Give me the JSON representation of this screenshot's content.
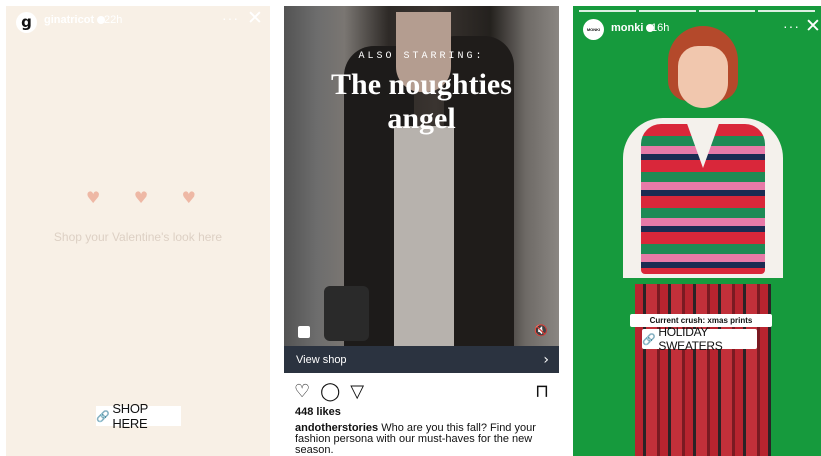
{
  "story1": {
    "avatar_letter": "g",
    "username": "ginatricot",
    "time": "22h",
    "more_glyph": "···",
    "close_glyph": "✕",
    "heart_glyph": "♥",
    "message": "Shop your Valentine's look here",
    "shop_button": "SHOP HERE",
    "link_glyph": "🔗"
  },
  "post2": {
    "subhead": "ALSO STARRING:",
    "headline_line1": "The noughties",
    "headline_line2": "angel",
    "view_shop": "View shop",
    "chevron_glyph": "›",
    "like_glyph": "♡",
    "comment_glyph": "◯",
    "share_glyph": "▽",
    "save_glyph": "⊓",
    "mute_glyph": "🔇",
    "likes": "448 likes",
    "caption_user": "andotherstories",
    "caption_text": " Who are you this fall? Find your fashion persona with our must-haves for the new season."
  },
  "story3": {
    "avatar_text": "MONKI",
    "username": "monki",
    "time": "16h",
    "more_glyph": "···",
    "close_glyph": "✕",
    "sticker_crush": "Current crush: xmas prints",
    "sticker_holiday": "HOLIDAY SWEATERS",
    "link_glyph": "🔗"
  },
  "colors": {
    "story1_bg": "#f8f0e6",
    "heart": "#eeb8a5",
    "story3_bg": "#169a3d",
    "view_shop_bar": "#2b3340",
    "link_accent": "#d43a8e"
  }
}
